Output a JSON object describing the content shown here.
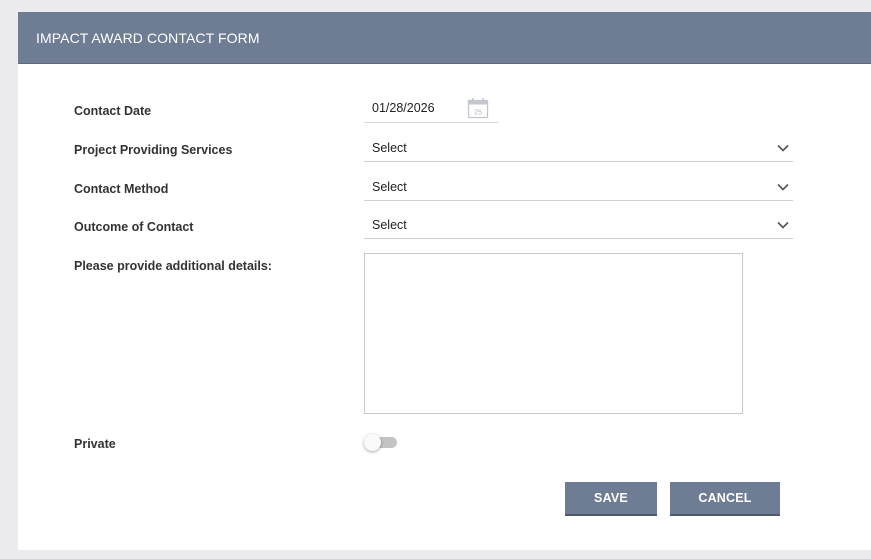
{
  "form": {
    "title": "IMPACT AWARD CONTACT FORM",
    "contact_date": {
      "label": "Contact Date",
      "value": "01/28/2026",
      "calendar_day": "25"
    },
    "project": {
      "label": "Project Providing Services",
      "value": "Select"
    },
    "method": {
      "label": "Contact Method",
      "value": "Select"
    },
    "outcome": {
      "label": "Outcome of Contact",
      "value": "Select"
    },
    "details": {
      "label": "Please provide additional details:",
      "value": ""
    },
    "private": {
      "label": "Private",
      "enabled": false
    },
    "save_label": "SAVE",
    "cancel_label": "CANCEL"
  },
  "icons": {
    "calendar": "calendar-icon",
    "chevron": "chevron-down-icon"
  },
  "colors": {
    "header": "#6f7d94",
    "button": "#6f7d94",
    "background": "#ebebf0"
  }
}
